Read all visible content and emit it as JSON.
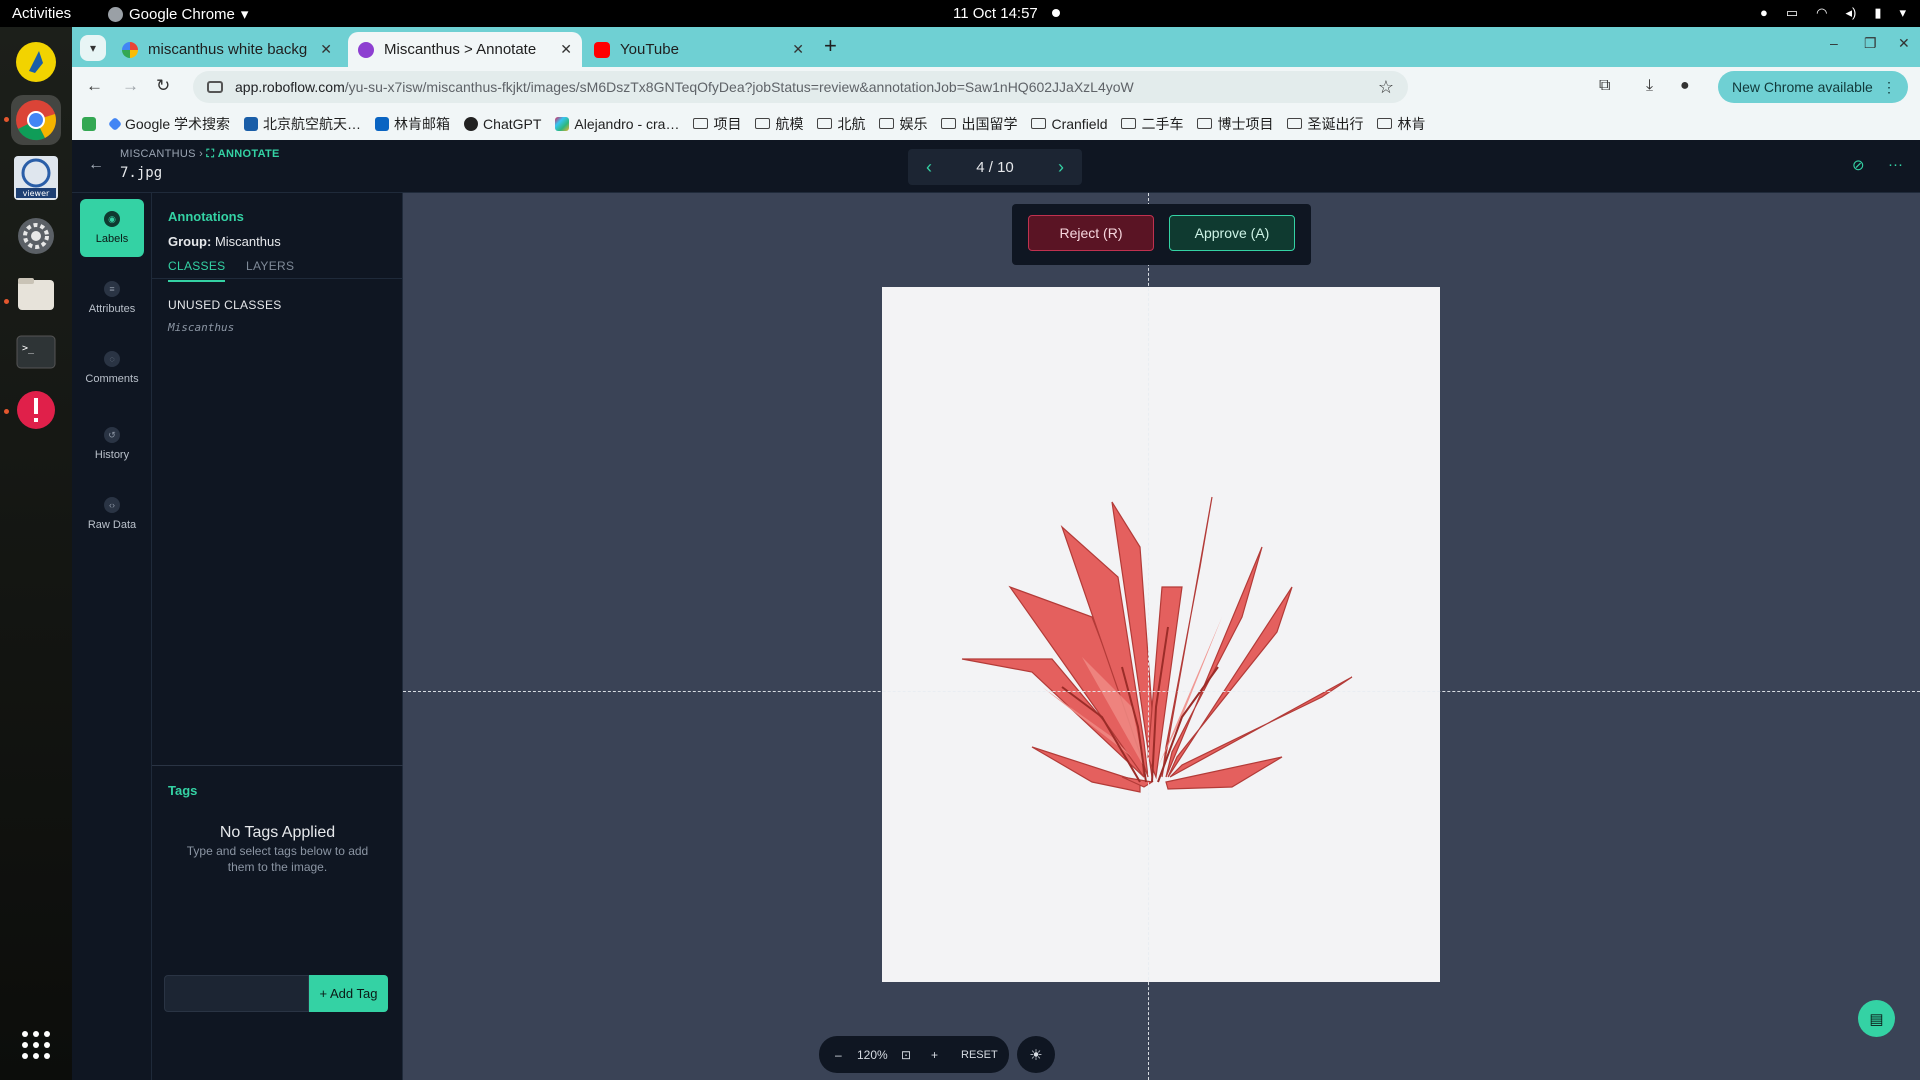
{
  "system": {
    "activities": "Activities",
    "app_name": "Google Chrome",
    "clock": "11 Oct  14:57"
  },
  "browser": {
    "tabs": [
      {
        "title": "miscanthus white backg",
        "icon": "google-icon",
        "active": false
      },
      {
        "title": "Miscanthus > Annotate",
        "icon": "roboflow-icon",
        "active": true
      },
      {
        "title": "YouTube",
        "icon": "youtube-icon",
        "active": false
      }
    ],
    "url_host": "app.roboflow.com",
    "url_path": "/yu-su-x7isw/miscanthus-fkjkt/images/sM6DszTx8GNTeqOfyDea?jobStatus=review&annotationJob=Saw1nHQ602JJaXzL4yoW",
    "update_label": "New Chrome available",
    "bookmarks": [
      {
        "label": "Google 学术搜索",
        "type": "link"
      },
      {
        "label": "北京航空航天…",
        "type": "link"
      },
      {
        "label": "林肯邮箱",
        "type": "link"
      },
      {
        "label": "ChatGPT",
        "type": "link"
      },
      {
        "label": "Alejandro - cra…",
        "type": "link"
      },
      {
        "label": "项目",
        "type": "folder"
      },
      {
        "label": "航模",
        "type": "folder"
      },
      {
        "label": "北航",
        "type": "folder"
      },
      {
        "label": "娱乐",
        "type": "folder"
      },
      {
        "label": "出国留学",
        "type": "folder"
      },
      {
        "label": "Cranfield",
        "type": "folder"
      },
      {
        "label": "二手车",
        "type": "folder"
      },
      {
        "label": "博士项目",
        "type": "folder"
      },
      {
        "label": "圣诞出行",
        "type": "folder"
      },
      {
        "label": "林肯",
        "type": "folder"
      }
    ]
  },
  "header": {
    "breadcrumb_project": "MISCANTHUS",
    "breadcrumb_sep": "›",
    "breadcrumb_page": "ANNOTATE",
    "filename": "7.jpg",
    "pager": "4 / 10"
  },
  "rail": {
    "items": [
      {
        "label": "Labels"
      },
      {
        "label": "Attributes"
      },
      {
        "label": "Comments"
      },
      {
        "label": "History"
      },
      {
        "label": "Raw Data"
      }
    ]
  },
  "panel": {
    "title": "Annotations",
    "group_label": "Group:",
    "group_value": "Miscanthus",
    "tabs": [
      "CLASSES",
      "LAYERS"
    ],
    "unused_title": "UNUSED CLASSES",
    "unused_classes": [
      "Miscanthus"
    ],
    "tags_title": "Tags",
    "tags_empty": "No Tags Applied",
    "tags_hint": "Type and select tags below to add them to the image.",
    "add_tag": "+ Add Tag"
  },
  "review": {
    "reject": "Reject (R)",
    "approve": "Approve (A)"
  },
  "zoom": {
    "minus": "–",
    "value": "120%",
    "plus": "+",
    "reset": "RESET"
  },
  "colors": {
    "accent": "#34d2a4",
    "reject": "#c0314f",
    "canvas": "#3a4356",
    "panel": "#0f1622"
  }
}
